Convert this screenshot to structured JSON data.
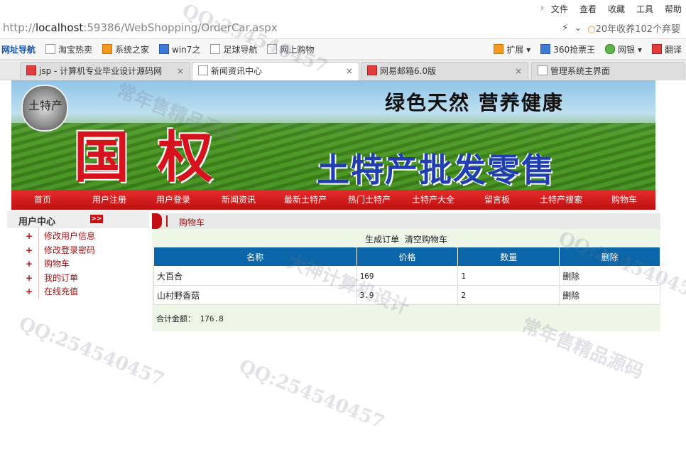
{
  "browser": {
    "menu": [
      "文件",
      "查看",
      "收藏",
      "工具",
      "帮助"
    ],
    "url_prefix": "http://",
    "url_host": "localhost",
    "url_rest": ":59386/WebShopping/OrderCar.aspx",
    "search_text": "20年收养102个弃婴",
    "favorites": [
      "网址导航",
      "淘宝热卖",
      "系统之家",
      "win7之",
      "足球导航",
      "网上购物"
    ],
    "fav_right": [
      "扩展",
      "360抢票王",
      "网银",
      "翻译"
    ],
    "tabs": [
      {
        "label": "jsp - 计算机专业毕业设计源码网"
      },
      {
        "label": "新闻资讯中心"
      },
      {
        "label": "网易邮箱6.0版"
      },
      {
        "label": "管理系统主界面"
      }
    ]
  },
  "banner": {
    "logo_text": "土特产",
    "slogan": "绿色天然  营养健康",
    "brand": "国权",
    "tagline": "土特产批发零售"
  },
  "nav": [
    "首页",
    "用户注册",
    "用户登录",
    "新闻资讯",
    "最新土特产",
    "热门土特产",
    "土特产大全",
    "留言板",
    "土特产搜索",
    "购物车"
  ],
  "sidebar": {
    "title": "用户中心",
    "arrow": ">>",
    "items": [
      "修改用户信息",
      "修改登录密码",
      "购物车",
      "我的订单",
      "在线充值"
    ]
  },
  "content": {
    "breadcrumb": "购物车",
    "actions": {
      "generate": "生成订单",
      "clear": "清空购物车"
    },
    "table": {
      "headers": [
        "名称",
        "价格",
        "数量",
        "删除"
      ],
      "rows": [
        {
          "name": "大百合",
          "price": "169",
          "qty": "1",
          "del": "删除"
        },
        {
          "name": "山村野香菇",
          "price": "3.9",
          "qty": "2",
          "del": "删除"
        }
      ]
    },
    "total_label": "合计金额：",
    "total_value": "176.8"
  },
  "watermarks": [
    "QQ:254540457",
    "大神计算机设计",
    "常年售精品源码"
  ]
}
